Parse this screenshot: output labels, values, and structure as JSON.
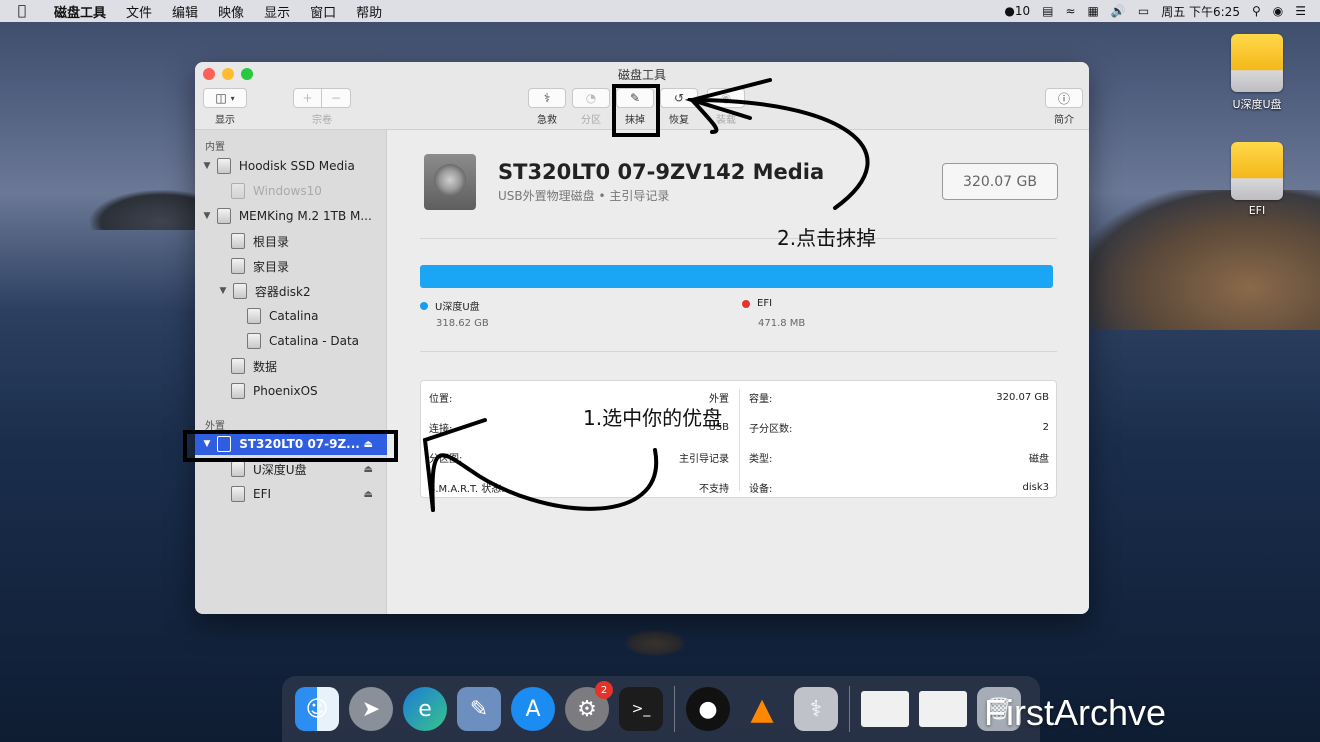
{
  "menubar": {
    "app_name": "磁盘工具",
    "items": [
      "文件",
      "编辑",
      "映像",
      "显示",
      "窗口",
      "帮助"
    ],
    "status": {
      "notifications": "10",
      "clock": "周五 下午6:25"
    }
  },
  "desktop": {
    "icons": [
      {
        "label": "U深度U盘"
      },
      {
        "label": "EFI"
      }
    ]
  },
  "window": {
    "title": "磁盘工具",
    "toolbar": {
      "view_label": "显示",
      "volume_label": "宗卷",
      "add_symbol": "+",
      "remove_symbol": "−",
      "first_aid_label": "急救",
      "partition_label": "分区",
      "erase_label": "抹掉",
      "restore_label": "恢复",
      "mount_label": "装载",
      "info_label": "简介"
    },
    "sidebar": {
      "internal_header": "内置",
      "external_header": "外置",
      "internal_items": [
        {
          "label": "Hoodisk SSD Media"
        },
        {
          "label": "Windows10"
        },
        {
          "label": "MEMKing M.2 1TB M..."
        },
        {
          "label": "根目录"
        },
        {
          "label": "家目录"
        },
        {
          "label": "容器disk2"
        },
        {
          "label": "Catalina"
        },
        {
          "label": "Catalina - Data"
        },
        {
          "label": "数据"
        },
        {
          "label": "PhoenixOS"
        }
      ],
      "external_items": [
        {
          "label": "ST320LT0 07-9Z..."
        },
        {
          "label": "U深度U盘"
        },
        {
          "label": "EFI"
        }
      ],
      "eject_symbol": "⏏"
    },
    "main": {
      "disk_name": "ST320LT0 07-9ZV142 Media",
      "disk_subtitle": "USB外置物理磁盘 • 主引导记录",
      "capacity_box": "320.07 GB",
      "partitions": [
        {
          "name": "U深度U盘",
          "size": "318.62 GB",
          "color": "#1a9cf0"
        },
        {
          "name": "EFI",
          "size": "471.8 MB",
          "color": "#e8312b"
        }
      ],
      "usage_bar_color": "#1aa5f5",
      "info_left": [
        {
          "key": "位置:",
          "value": "外置"
        },
        {
          "key": "连接:",
          "value": "USB"
        },
        {
          "key": "分区图:",
          "value": "主引导记录"
        },
        {
          "key": "S.M.A.R.T. 状态:",
          "value": "不支持"
        }
      ],
      "info_right": [
        {
          "key": "容量:",
          "value": "320.07 GB"
        },
        {
          "key": "子分区数:",
          "value": "2"
        },
        {
          "key": "类型:",
          "value": "磁盘"
        },
        {
          "key": "设备:",
          "value": "disk3"
        }
      ]
    }
  },
  "annotations": {
    "step1": "1.选中你的优盘",
    "step2": "2.点击抹掉"
  },
  "dock": {
    "settings_badge": "2",
    "apps": [
      "finder-icon",
      "launchpad-icon",
      "edge-icon",
      "preview-icon",
      "app-store-icon",
      "system-preferences-icon",
      "terminal-icon",
      "qq-icon",
      "vlc-icon",
      "disk-utility-icon",
      "window-thumbnail-icon",
      "window-thumbnail-icon",
      "trash-icon"
    ]
  },
  "watermark": "FirstArchve"
}
